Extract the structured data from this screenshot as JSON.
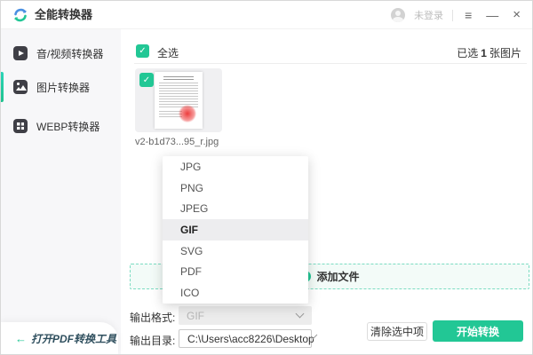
{
  "window": {
    "title": "全能转换器",
    "titlebar": {
      "login_label": "未登录",
      "menu_icon": "≡",
      "minimize_icon": "—",
      "close_icon": "×"
    }
  },
  "icons": {
    "check": "✓",
    "plus": "+",
    "back_arrow": "←"
  },
  "sidebar": {
    "items": [
      {
        "label": "音/视频转换器",
        "icon": "video-converter-icon",
        "active": false
      },
      {
        "label": "图片转换器",
        "icon": "image-converter-icon",
        "active": true
      },
      {
        "label": "WEBP转换器",
        "icon": "webp-converter-icon",
        "active": false
      }
    ],
    "pdf_tool_button": {
      "label": "打开PDF转换工具"
    }
  },
  "main": {
    "select_all_label": "全选",
    "selected": {
      "prefix": "已选",
      "count": "1",
      "suffix": "张图片"
    },
    "file": {
      "name": "v2-b1d73...95_r.jpg",
      "checked": true
    },
    "add_file_label": "添加文件",
    "format_dropdown": {
      "options": [
        "JPG",
        "PNG",
        "JPEG",
        "GIF",
        "SVG",
        "PDF",
        "ICO"
      ],
      "selected": "GIF"
    },
    "output_format": {
      "label": "输出格式:",
      "value": "GIF"
    },
    "output_dir": {
      "label": "输出目录:",
      "value": "C:\\Users\\acc8226\\Desktop"
    },
    "buttons": {
      "clear": "清除选中项",
      "start": "开始转换"
    }
  },
  "colors": {
    "accent": "#22c795",
    "accent_light": "#7bdcc2",
    "stamp_red": "#eb2828"
  }
}
